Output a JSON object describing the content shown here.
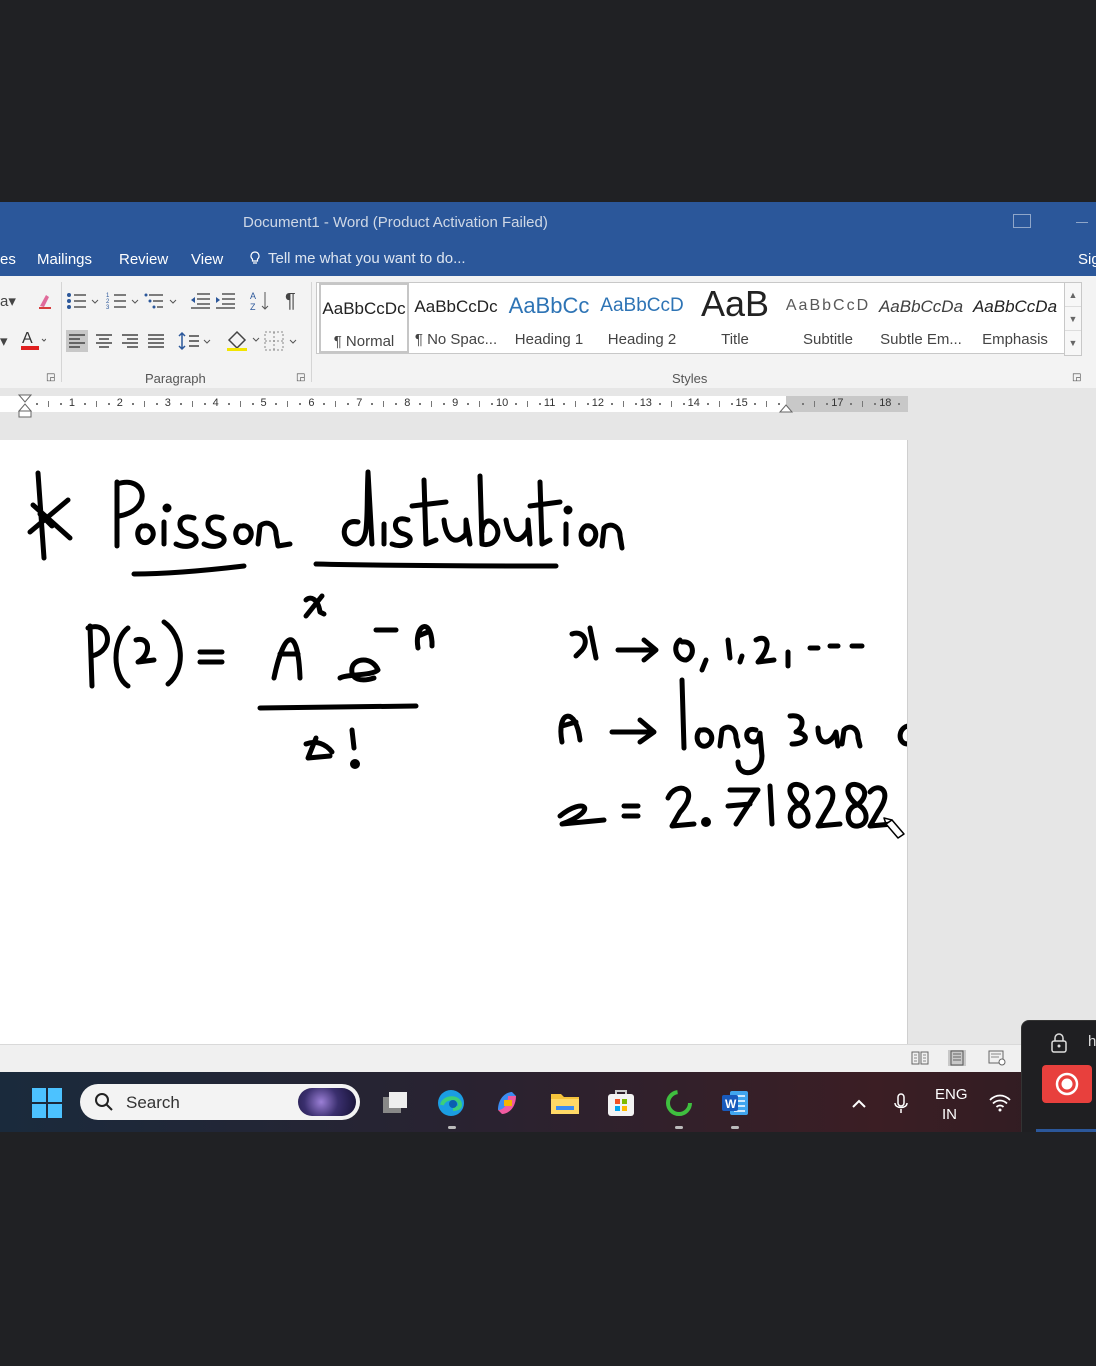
{
  "window": {
    "title": "Document1 - Word (Product Activation Failed)"
  },
  "tabs": {
    "partial_left": "es",
    "items": [
      "Mailings",
      "Review",
      "View"
    ],
    "tell_me": "Tell me what you want to do...",
    "sign_in": "Sig"
  },
  "ribbon": {
    "paragraph_label": "Paragraph",
    "styles_label": "Styles",
    "styles": [
      {
        "preview": "AaBbCcDc",
        "name": "¶ Normal",
        "selected": true
      },
      {
        "preview": "AaBbCcDc",
        "name": "¶ No Spac..."
      },
      {
        "preview": "AaBbCc",
        "name": "Heading 1"
      },
      {
        "preview": "AaBbCcD",
        "name": "Heading 2"
      },
      {
        "preview": "AaB",
        "name": "Title"
      },
      {
        "preview": "AaBbCcD",
        "name": "Subtitle"
      },
      {
        "preview": "AaBbCcDa",
        "name": "Subtle Em..."
      },
      {
        "preview": "AaBbCcDa",
        "name": "Emphasis"
      }
    ]
  },
  "ruler": {
    "numbers": [
      "1",
      "2",
      "3",
      "4",
      "5",
      "6",
      "7",
      "8",
      "9",
      "10",
      "11",
      "12",
      "13",
      "14",
      "15",
      "17",
      "18"
    ]
  },
  "document": {
    "handwriting": {
      "heading": "* Poisson distribution",
      "formula_lhs": "P(x) =",
      "formula_numerator": "λ^x e^-λ",
      "formula_denominator": "x!",
      "note_x": "x → 0, 1, 2, . . .",
      "note_lambda": "λ → long run average",
      "note_e": "e = 2.718282"
    }
  },
  "taskbar": {
    "search_label": "Search",
    "language": "ENG",
    "region": "IN"
  },
  "colors": {
    "word_blue": "#2b579a",
    "record_red": "#e8403d"
  }
}
